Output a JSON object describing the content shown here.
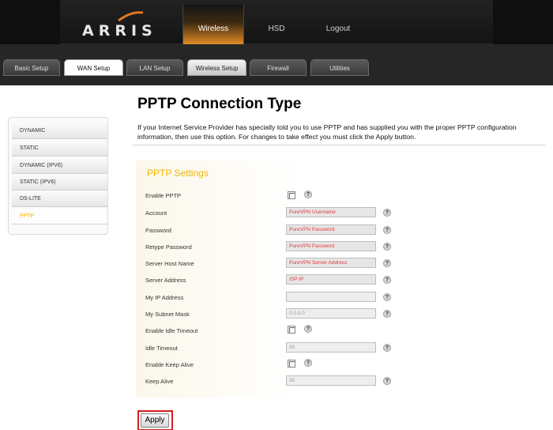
{
  "brand": {
    "logo_text": "ARRIS"
  },
  "top_nav": {
    "items": [
      "Wireless",
      "HSD",
      "Logout"
    ],
    "active": "Wireless"
  },
  "sub_nav": {
    "items": [
      "Basic Setup",
      "WAN Setup",
      "LAN Setup",
      "Wireless Setup",
      "Firewall",
      "Utilities"
    ]
  },
  "side_menu": {
    "items": [
      "DYNAMIC",
      "STATIC",
      "DYNAMIC (IPV6)",
      "STATIC (IPV6)",
      "DS-LITE",
      "PPTP"
    ],
    "active": "PPTP"
  },
  "main": {
    "title": "PPTP Connection Type",
    "intro": "If your Internet Service Provider has specially told you to use PPTP and has supplied you with the proper PPTP configuration information, then use this option. For changes to take effect you must click the Apply button.",
    "section_title": "PPTP Settings",
    "fields": {
      "enable_pptp": {
        "label": "Enable PPTP"
      },
      "account": {
        "label": "Account",
        "value": "PureVPN Username"
      },
      "password": {
        "label": "Password",
        "value": "PureVPN Password"
      },
      "retype_password": {
        "label": "Retype Password",
        "value": "PureVPN Password"
      },
      "server_host_name": {
        "label": "Server Host Name",
        "value": "PureVPN Server Address"
      },
      "server_address": {
        "label": "Server Address",
        "value": "ISP IP"
      },
      "my_ip_address": {
        "label": "My IP Address",
        "value": ""
      },
      "my_subnet_mask": {
        "label": "My Subnet Mask",
        "value": "0.0.0.0"
      },
      "enable_idle_timeout": {
        "label": "Enable Idle Timeout"
      },
      "idle_timeout": {
        "label": "Idle Timeout",
        "value": "30"
      },
      "enable_keep_alive": {
        "label": "Enable Keep Alive"
      },
      "keep_alive": {
        "label": "Keep Alive",
        "value": "30"
      }
    },
    "help_glyph": "?",
    "apply_label": "Apply"
  },
  "colors": {
    "accent": "#f2b500",
    "highlight": "#d22020",
    "value_text": "#e23b3b"
  }
}
